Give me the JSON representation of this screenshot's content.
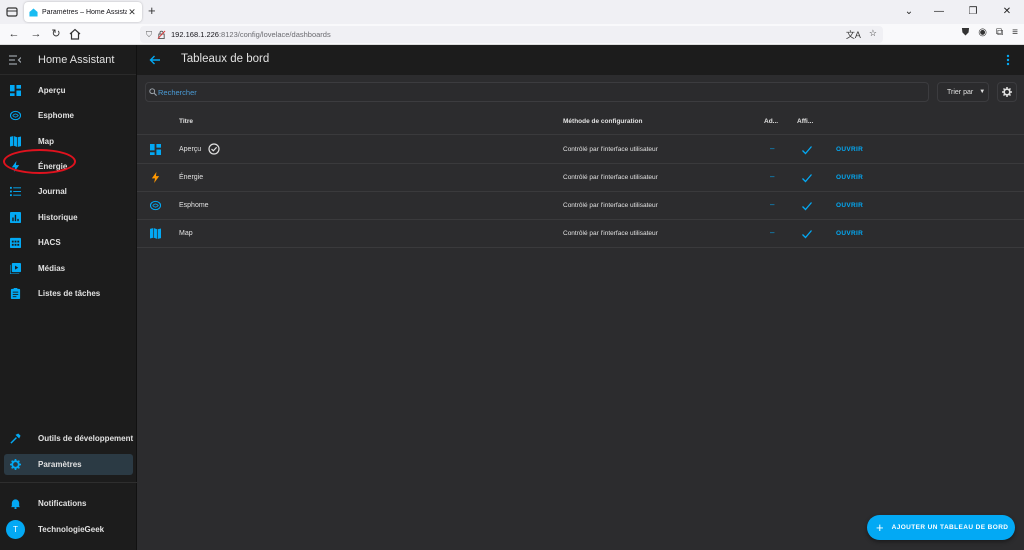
{
  "browser": {
    "tab_title": "Paramètres – Home Assistant",
    "url_host": "192.168.1.226",
    "url_rest": ":8123/config/lovelace/dashboards"
  },
  "sidebar": {
    "title": "Home Assistant",
    "items": [
      {
        "label": "Aperçu",
        "icon": "view-dashboard-icon"
      },
      {
        "label": "Esphome",
        "icon": "esphome-icon"
      },
      {
        "label": "Map",
        "icon": "map-icon"
      },
      {
        "label": "Énergie",
        "icon": "lightning-icon"
      },
      {
        "label": "Journal",
        "icon": "list-icon"
      },
      {
        "label": "Historique",
        "icon": "chart-box-icon"
      },
      {
        "label": "HACS",
        "icon": "hacs-icon"
      },
      {
        "label": "Médias",
        "icon": "play-box-icon"
      },
      {
        "label": "Listes de tâches",
        "icon": "clipboard-list-icon"
      }
    ],
    "bottom": {
      "dev_tools": "Outils de développement",
      "settings": "Paramètres",
      "notifications": "Notifications",
      "user": "TechnologieGeek",
      "user_initial": "T"
    }
  },
  "header": {
    "title": "Tableaux de bord"
  },
  "search": {
    "placeholder": "Rechercher"
  },
  "sort": {
    "label": "Trier par"
  },
  "table": {
    "columns": {
      "title": "Titre",
      "method": "Méthode de configuration",
      "admin": "Ad...",
      "sidebar": "Affi..."
    },
    "rows": [
      {
        "title": "Aperçu",
        "method": "Contrôlé par l'interface utilisateur",
        "admin": "–",
        "open": "OUVRIR",
        "icon": "view-dashboard-icon",
        "default": true
      },
      {
        "title": "Énergie",
        "method": "Contrôlé par l'interface utilisateur",
        "admin": "–",
        "open": "OUVRIR",
        "icon": "lightning-icon",
        "default": false
      },
      {
        "title": "Esphome",
        "method": "Contrôlé par l'interface utilisateur",
        "admin": "–",
        "open": "OUVRIR",
        "icon": "esphome-icon",
        "default": false
      },
      {
        "title": "Map",
        "method": "Contrôlé par l'interface utilisateur",
        "admin": "–",
        "open": "OUVRIR",
        "icon": "map-icon",
        "default": false
      }
    ]
  },
  "fab": {
    "label": "AJOUTER UN TABLEAU DE BORD"
  },
  "colors": {
    "accent": "#03a9f4",
    "sidebar_bg": "#1c1c1c",
    "content_bg": "#2c2c2e",
    "active_item_bg": "#2b3a44",
    "energy": "#ff9800",
    "annotation": "#e0121e"
  }
}
